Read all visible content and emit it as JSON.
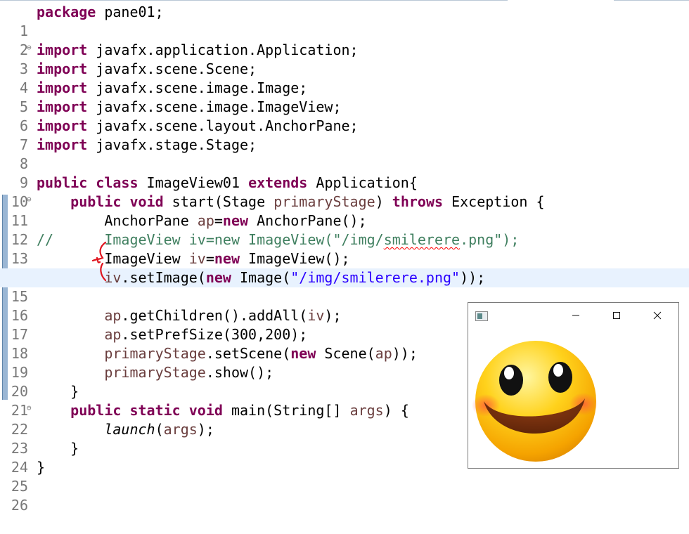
{
  "editor": {
    "lines": [
      {
        "n": "1"
      },
      {
        "n": "2"
      },
      {
        "n": "3"
      },
      {
        "n": "4"
      },
      {
        "n": "5"
      },
      {
        "n": "6"
      },
      {
        "n": "7"
      },
      {
        "n": "8"
      },
      {
        "n": "9"
      },
      {
        "n": "10"
      },
      {
        "n": "11"
      },
      {
        "n": "12"
      },
      {
        "n": "13"
      },
      {
        "n": "14"
      },
      {
        "n": "15"
      },
      {
        "n": "16"
      },
      {
        "n": "17"
      },
      {
        "n": "18"
      },
      {
        "n": "19"
      },
      {
        "n": "20"
      },
      {
        "n": "21"
      },
      {
        "n": "22"
      },
      {
        "n": "23"
      },
      {
        "n": "24"
      },
      {
        "n": "25"
      },
      {
        "n": "26"
      }
    ],
    "code": {
      "l1_kw": "package",
      "l1_rest": " pane01;",
      "l3_kw": "import",
      "l3_rest": " javafx.application.Application;",
      "l4_kw": "import",
      "l4_rest": " javafx.scene.Scene;",
      "l5_kw": "import",
      "l5_rest": " javafx.scene.image.Image;",
      "l6_kw": "import",
      "l6_rest": " javafx.scene.image.ImageView;",
      "l7_kw": "import",
      "l7_rest": " javafx.scene.layout.AnchorPane;",
      "l8_kw": "import",
      "l8_rest": " javafx.stage.Stage;",
      "l10_kw1": "public",
      "l10_kw2": "class",
      "l10_name": " ImageView01 ",
      "l10_kw3": "extends",
      "l10_rest": " Application{",
      "l11_kw1": "public",
      "l11_kw2": "void",
      "l11_a": " start(Stage ",
      "l11_param": "primaryStage",
      "l11_b": ") ",
      "l11_kw3": "throws",
      "l11_c": " Exception {",
      "l12_a": "AnchorPane ",
      "l12_var": "ap",
      "l12_b": "=",
      "l12_kw": "new",
      "l12_c": " AnchorPane();",
      "l13_slash": "//",
      "l13_a": "ImageView iv=new ImageView(\"/img/",
      "l13_sq": "smilerere",
      "l13_b": ".png\");",
      "l14_a": "ImageView ",
      "l14_var": "iv",
      "l14_b": "=",
      "l14_kw": "new",
      "l14_c": " ImageView();",
      "l15_var": "iv",
      "l15_a": ".setImage(",
      "l15_kw": "new",
      "l15_b": " Image(",
      "l15_str": "\"/img/smilerere.png\"",
      "l15_c": "));",
      "l17_var": "ap",
      "l17_a": ".getChildren().addAll(",
      "l17_arg": "iv",
      "l17_b": ");",
      "l18_var": "ap",
      "l18_a": ".setPrefSize(300,200);",
      "l19_var": "primaryStage",
      "l19_a": ".setScene(",
      "l19_kw": "new",
      "l19_b": " Scene(",
      "l19_arg": "ap",
      "l19_c": "));",
      "l20_var": "primaryStage",
      "l20_a": ".show();",
      "l21": "}",
      "l22_kw1": "public",
      "l22_kw2": "static",
      "l22_kw3": "void",
      "l22_a": " main(String[] ",
      "l22_param": "args",
      "l22_b": ") {",
      "l23_fn": "launch",
      "l23_a": "(",
      "l23_param": "args",
      "l23_b": ");",
      "l24": "}",
      "l25": "}"
    }
  },
  "window": {
    "minimize_glyph": "—",
    "maximize_glyph": "☐",
    "close_glyph": "✕",
    "content_image": "smiley-face-emoji"
  },
  "colors": {
    "keyword": "#7f0055",
    "string": "#2a00ff",
    "comment": "#3f7f5f",
    "variable": "#6a3e3e",
    "highlight": "#e8f2fe",
    "annotation_red": "#e0141e"
  }
}
